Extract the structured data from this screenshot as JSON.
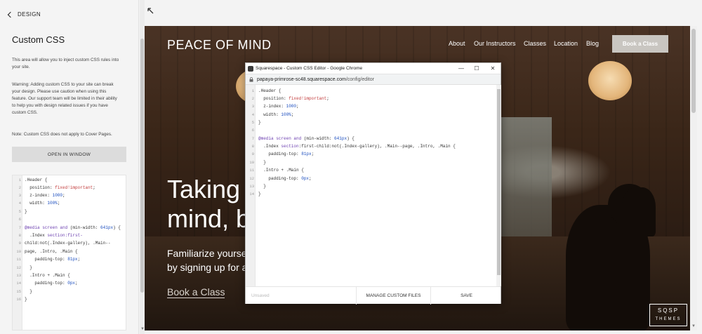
{
  "panel": {
    "back_label": "DESIGN",
    "title": "Custom CSS",
    "intro": "This area will allow you to inject custom CSS rules into your site.",
    "warning_lines": [
      "Warning: Adding custom CSS to your site can break",
      "your design. Please use caution when using this",
      "feature. Our support team will be limited in their ability",
      "to help you with design related issues if you have",
      "custom CSS."
    ],
    "note": "Note: Custom CSS does not apply to Cover Pages.",
    "open_button": "OPEN IN WINDOW",
    "line_numbers": [
      "1",
      "2",
      "3",
      "4",
      "5",
      "6",
      "7",
      "8",
      "9",
      "10",
      "11",
      "12",
      "13",
      "14",
      "15",
      "16"
    ],
    "code": {
      "l1": ".Header {",
      "l2a": "  position: ",
      "l2b": "fixed!important",
      "l2c": ";",
      "l3a": "  z-index: ",
      "l3b": "1000",
      "l3c": ";",
      "l4a": "  width: ",
      "l4b": "100%",
      "l4c": ";",
      "l5": "}",
      "l6a": "@media",
      "l6b": " screen ",
      "l6c": "and",
      "l6d": " (min-width: ",
      "l6e": "641px",
      "l6f": ") {",
      "l7a": "  .Index ",
      "l7b": "section:first-",
      "l8": "child:not(.Index-gallery), .Main--",
      "l9": "page, .Intro, .Main {",
      "l10a": "    padding-top: ",
      "l10b": "81px",
      "l10c": ";",
      "l11": "  }",
      "l12": "  .Intro + .Main {",
      "l13a": "    padding-top: ",
      "l13b": "0px",
      "l13c": ";",
      "l14": "  }",
      "l15": "}"
    }
  },
  "site": {
    "logo": "PEACE OF MIND",
    "nav": [
      "About",
      "Our Instructors",
      "Classes",
      "Location",
      "Blog"
    ],
    "book_button": "Book a Class",
    "hero_line1": "Taking",
    "hero_line2": "mind, b",
    "sub_line1": "Familiarize yourse",
    "sub_line2": "by signing up for a",
    "hero_link": "Book a Class",
    "badge_top": "SQSP",
    "badge_bottom": "THEMES"
  },
  "popup": {
    "title": "Squarespace - Custom CSS Editor - Google Chrome",
    "url_host": "papaya-primrose-sc48.squarespace.com",
    "url_path": "/config/editor",
    "minimize": "—",
    "maximize": "☐",
    "close": "✕",
    "line_numbers": [
      "1",
      "2",
      "3",
      "4",
      "5",
      "6",
      "7",
      "8",
      "9",
      "10",
      "11",
      "12",
      "13",
      "14"
    ],
    "code": {
      "l1": ".Header {",
      "l2a": "  position: ",
      "l2b": "fixed!important",
      "l2c": ";",
      "l3a": "  z-index: ",
      "l3b": "1000",
      "l3c": ";",
      "l4a": "  width: ",
      "l4b": "100%",
      "l4c": ";",
      "l5": "}",
      "l6": "",
      "l7a": "@media",
      "l7b": " screen ",
      "l7c": "and",
      "l7d": " (min-width: ",
      "l7e": "641px",
      "l7f": ") {",
      "l8a": "  .Index ",
      "l8b": "section",
      "l8c": ":first-child:not(.Index-gallery), .Main--page, .Intro, .Main {",
      "l9a": "    padding-top: ",
      "l9b": "81px",
      "l9c": ";",
      "l10": "  }",
      "l11": "  .Intro + .Main {",
      "l12a": "    padding-top: ",
      "l12b": "0px",
      "l12c": ";",
      "l13": "  }",
      "l14": "}"
    },
    "status": "Unsaved",
    "manage_button": "MANAGE CUSTOM FILES",
    "save_button": "SAVE"
  }
}
